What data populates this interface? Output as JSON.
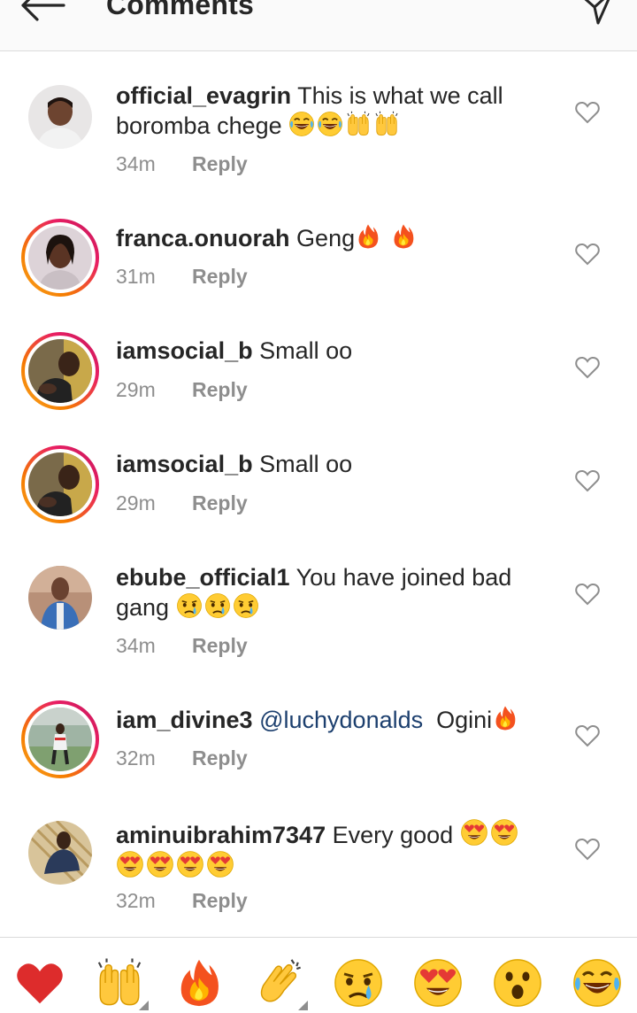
{
  "header": {
    "title": "Comments"
  },
  "comments": [
    {
      "username": "official_evagrin",
      "text": "This is what we call boromba chege",
      "emojis": [
        "joy",
        "joy",
        "raised-hands",
        "raised-hands"
      ],
      "time": "34m",
      "reply": "Reply",
      "story_ring": false
    },
    {
      "username": "franca.onuorah",
      "text": "Geng",
      "emojis": [
        "fire",
        "fire"
      ],
      "time": "31m",
      "reply": "Reply",
      "story_ring": true
    },
    {
      "username": "iamsocial_b",
      "text": "Small oo",
      "emojis": [],
      "time": "29m",
      "reply": "Reply",
      "story_ring": true
    },
    {
      "username": "iamsocial_b",
      "text": "Small oo",
      "emojis": [],
      "time": "29m",
      "reply": "Reply",
      "story_ring": true
    },
    {
      "username": "ebube_official1",
      "text": "You have joined bad gang",
      "emojis": [
        "crying",
        "crying",
        "crying"
      ],
      "time": "34m",
      "reply": "Reply",
      "story_ring": false
    },
    {
      "username": "iam_divine3",
      "mention": "@luchydonalds",
      "text": "Ogini",
      "emojis": [
        "fire"
      ],
      "time": "32m",
      "reply": "Reply",
      "story_ring": true
    },
    {
      "username": "aminuibrahim7347",
      "text": "Every  good",
      "emojis": [
        "heart-eyes",
        "heart-eyes",
        "heart-eyes",
        "heart-eyes",
        "heart-eyes",
        "heart-eyes"
      ],
      "time": "32m",
      "reply": "Reply",
      "story_ring": false
    }
  ],
  "quick_reactions": [
    "red-heart",
    "raised-hands",
    "fire",
    "clapping-hands",
    "crying-face",
    "heart-eyes-face",
    "surprised-face",
    "tears-of-joy-face"
  ],
  "colors": {
    "text": "#262626",
    "secondary": "#8e8e8e",
    "mention": "#1c3f6e",
    "divider": "#dbdbdb",
    "header_bg": "#fafafa"
  }
}
